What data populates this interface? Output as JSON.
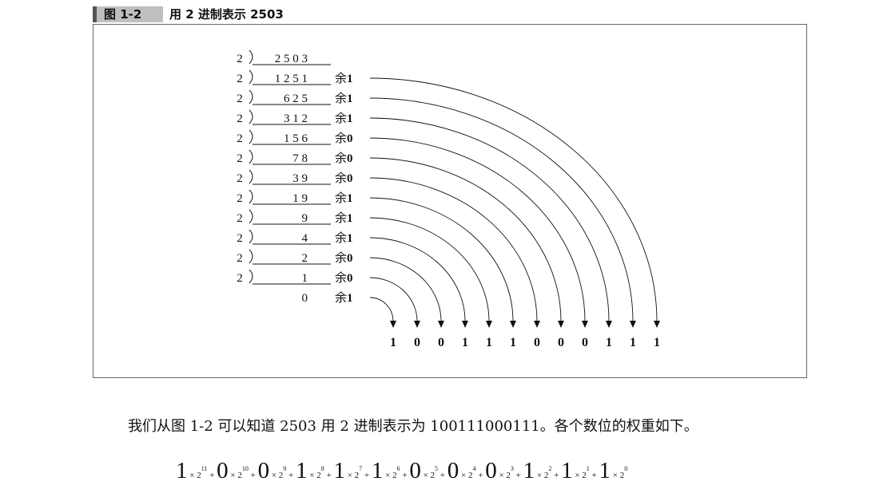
{
  "figure": {
    "label": "图 1-2",
    "title": "用 2 进制表示 2503"
  },
  "division": {
    "divisor": "2",
    "remainder_prefix": "余",
    "rows": [
      {
        "quotient": "2 5 0 3",
        "remainder": ""
      },
      {
        "quotient": "1 2 5 1",
        "remainder": "1"
      },
      {
        "quotient": "6 2 5",
        "remainder": "1"
      },
      {
        "quotient": "3 1 2",
        "remainder": "1"
      },
      {
        "quotient": "1 5 6",
        "remainder": "0"
      },
      {
        "quotient": "7 8",
        "remainder": "0"
      },
      {
        "quotient": "3 9",
        "remainder": "0"
      },
      {
        "quotient": "1 9",
        "remainder": "1"
      },
      {
        "quotient": "9",
        "remainder": "1"
      },
      {
        "quotient": "4",
        "remainder": "1"
      },
      {
        "quotient": "2",
        "remainder": "0"
      },
      {
        "quotient": "1",
        "remainder": "0"
      },
      {
        "quotient": "0",
        "remainder": "1"
      }
    ],
    "result_digits": [
      "1",
      "0",
      "0",
      "1",
      "1",
      "1",
      "0",
      "0",
      "0",
      "1",
      "1",
      "1"
    ]
  },
  "body_text": "我们从图 1-2 可以知道 2503 用 2 进制表示为 100111000111。各个数位的权重如下。",
  "formula": {
    "times": "×",
    "plus": "+",
    "base": "2",
    "terms": [
      {
        "digit": "1",
        "exp": "11"
      },
      {
        "digit": "0",
        "exp": "10"
      },
      {
        "digit": "0",
        "exp": "9"
      },
      {
        "digit": "1",
        "exp": "8"
      },
      {
        "digit": "1",
        "exp": "7"
      },
      {
        "digit": "1",
        "exp": "6"
      },
      {
        "digit": "0",
        "exp": "5"
      },
      {
        "digit": "0",
        "exp": "4"
      },
      {
        "digit": "0",
        "exp": "3"
      },
      {
        "digit": "1",
        "exp": "2"
      },
      {
        "digit": "1",
        "exp": "1"
      },
      {
        "digit": "1",
        "exp": "0"
      }
    ]
  }
}
